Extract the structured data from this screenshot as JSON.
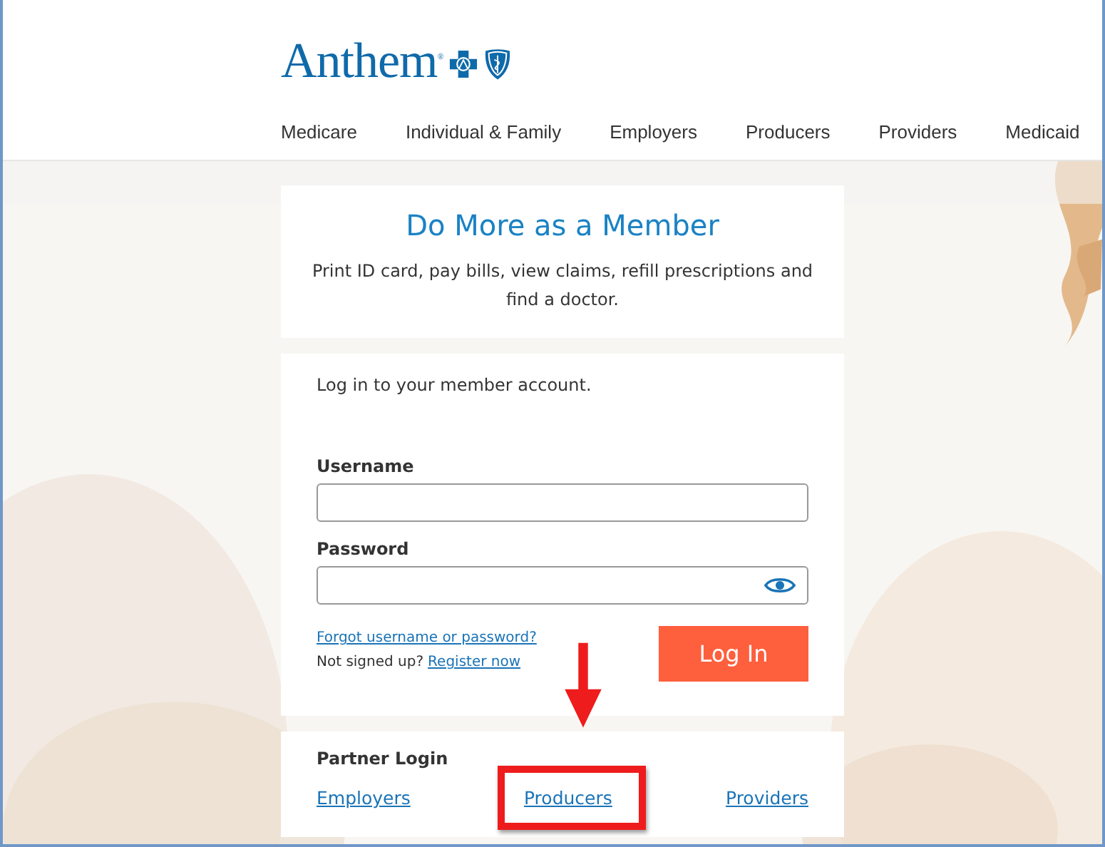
{
  "header": {
    "logo_text": "Anthem$^{®}$",
    "nav": [
      "Medicare",
      "Individual & Family",
      "Employers",
      "Producers",
      "Providers",
      "Medicaid"
    ]
  },
  "promo": {
    "title": "Do More as a Member",
    "text": "Print ID card, pay bills, view claims, refill prescriptions and find a doctor."
  },
  "login": {
    "intro": "Log in to your member account.",
    "username_label": "Username",
    "password_label": "Password",
    "forgot_link": "Forgot username or password?",
    "signup_text": "Not signed up?",
    "register_link": "Register now",
    "button": "Log In"
  },
  "partner": {
    "title": "Partner Login",
    "links": [
      {
        "label": "Employers",
        "highlighted": false
      },
      {
        "label": "Producers",
        "highlighted": true
      },
      {
        "label": "Providers",
        "highlighted": false
      }
    ]
  }
}
